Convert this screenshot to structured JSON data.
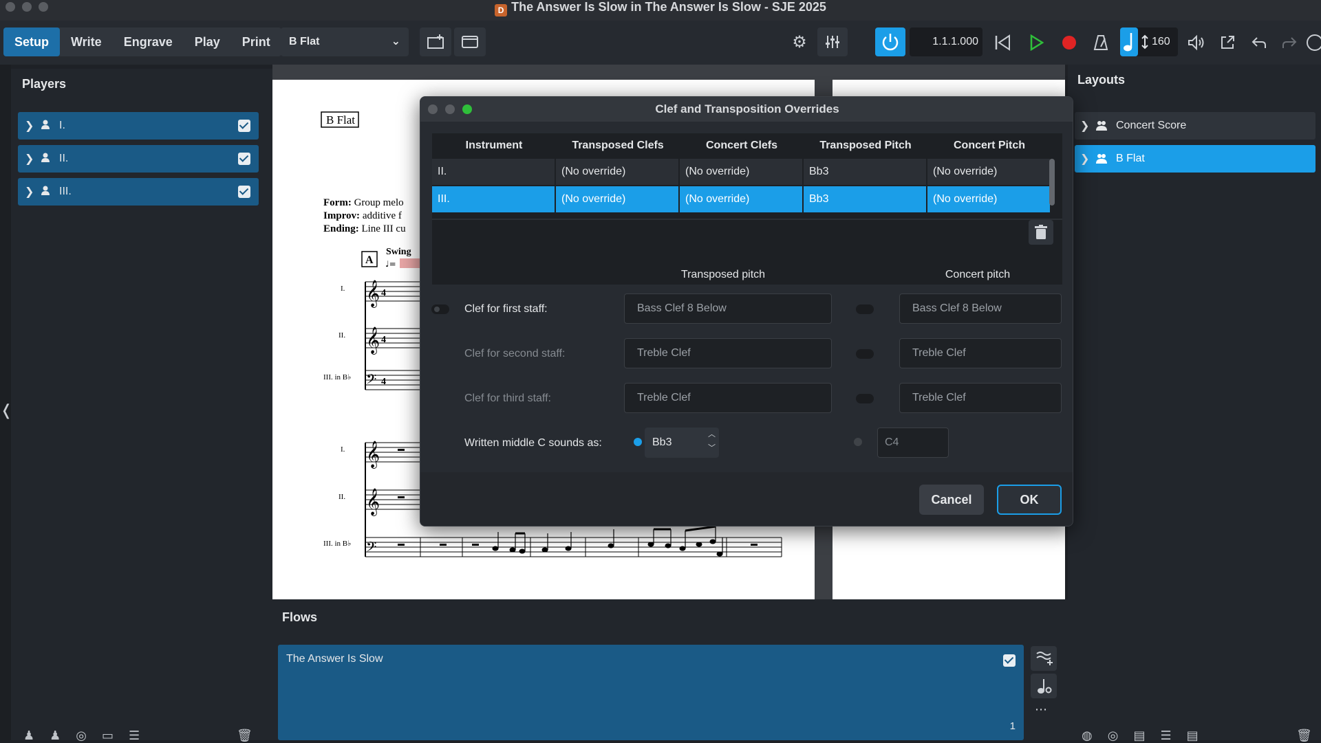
{
  "window": {
    "title": "The Answer Is Slow in The Answer Is Slow - SJE 2025"
  },
  "toolbar": {
    "modes": [
      "Setup",
      "Write",
      "Engrave",
      "Play",
      "Print"
    ],
    "active_mode": "Setup",
    "layout_selected": "B Flat",
    "timecode": "1.1.1.000",
    "tempo": "160"
  },
  "players_panel": {
    "title": "Players",
    "players": [
      {
        "label": "I."
      },
      {
        "label": "II."
      },
      {
        "label": "III."
      }
    ]
  },
  "layouts_panel": {
    "title": "Layouts",
    "layouts": [
      {
        "label": "Concert Score",
        "selected": false
      },
      {
        "label": "B Flat",
        "selected": true
      }
    ]
  },
  "flows_panel": {
    "title": "Flows",
    "flow": {
      "title": "The Answer Is Slow",
      "number": "1"
    }
  },
  "score": {
    "layout_label": "B Flat",
    "text_form_label": "Form:",
    "text_form": "Group melo",
    "text_improv_label": "Improv:",
    "text_improv": "additive f",
    "text_ending_label": "Ending:",
    "text_ending": "Line III cu",
    "rehearsal_mark": "A",
    "tempo_text": "Swing",
    "staff_labels": [
      "I.",
      "II.",
      "III. in B♭",
      "I.",
      "II.",
      "III. in B♭"
    ]
  },
  "dialog": {
    "title": "Clef and Transposition Overrides",
    "table": {
      "columns": [
        "Instrument",
        "Transposed Clefs",
        "Concert Clefs",
        "Transposed Pitch",
        "Concert Pitch"
      ],
      "rows": [
        {
          "cells": [
            "II.",
            "(No override)",
            "(No override)",
            "Bb3",
            "(No override)"
          ],
          "selected": false
        },
        {
          "cells": [
            "III.",
            "(No override)",
            "(No override)",
            "Bb3",
            "(No override)"
          ],
          "selected": true
        }
      ]
    },
    "transposed_header": "Transposed pitch",
    "concert_header": "Concert pitch",
    "fields": {
      "first_label": "Clef for first staff:",
      "second_label": "Clef for second staff:",
      "third_label": "Clef for third staff:",
      "first_transposed": "Bass Clef 8 Below",
      "first_concert": "Bass Clef 8 Below",
      "second_transposed": "Treble Clef",
      "second_concert": "Treble Clef",
      "third_transposed": "Treble Clef",
      "third_concert": "Treble Clef",
      "middle_c_label": "Written middle C sounds as:",
      "middle_c_transposed": "Bb3",
      "middle_c_concert": "C4"
    },
    "cancel_label": "Cancel",
    "ok_label": "OK"
  },
  "colors": {
    "accent": "#1b9ee8",
    "selection": "#1a5a86",
    "record": "#e02424",
    "play": "#2fbf3a"
  }
}
